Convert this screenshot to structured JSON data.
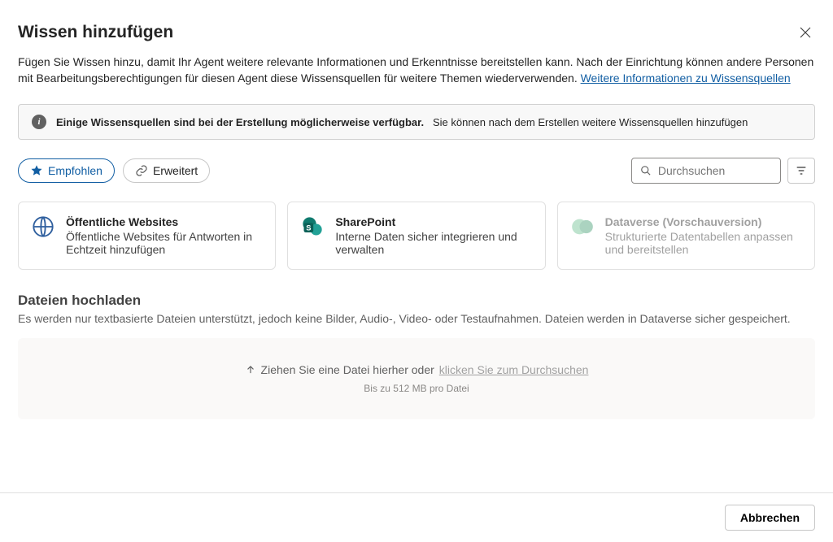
{
  "header": {
    "title": "Wissen hinzufügen"
  },
  "description": {
    "text": "Fügen Sie Wissen hinzu, damit Ihr Agent weitere relevante Informationen und Erkenntnisse bereitstellen kann. Nach der Einrichtung können andere Personen mit Bearbeitungsberechtigungen für diesen Agent diese Wissensquellen für weitere Themen wiederverwenden. ",
    "link": "Weitere Informationen zu Wissensquellen"
  },
  "infobar": {
    "bold": "Einige Wissensquellen sind bei der Erstellung möglicherweise verfügbar.",
    "rest": "Sie können nach dem Erstellen weitere Wissensquellen hinzufügen"
  },
  "tabs": {
    "featured": "Empfohlen",
    "advanced": "Erweitert"
  },
  "search": {
    "placeholder": "Durchsuchen"
  },
  "cards": [
    {
      "title": "Öffentliche Websites",
      "desc": "Öffentliche Websites für Antworten in Echtzeit hinzufügen"
    },
    {
      "title": "SharePoint",
      "desc": "Interne Daten sicher integrieren und verwalten"
    },
    {
      "title": "Dataverse (Vorschauversion)",
      "desc": "Strukturierte Datentabellen anpassen und bereitstellen"
    }
  ],
  "upload": {
    "title": "Dateien hochladen",
    "subtitle": "Es werden nur textbasierte Dateien unterstützt, jedoch keine Bilder, Audio-, Video- oder Testaufnahmen. Dateien werden in Dataverse sicher gespeichert.",
    "drag_text": "Ziehen Sie eine Datei hierher oder ",
    "browse": "klicken Sie zum Durchsuchen",
    "limit": "Bis zu 512 MB pro Datei"
  },
  "footer": {
    "cancel": "Abbrechen"
  }
}
